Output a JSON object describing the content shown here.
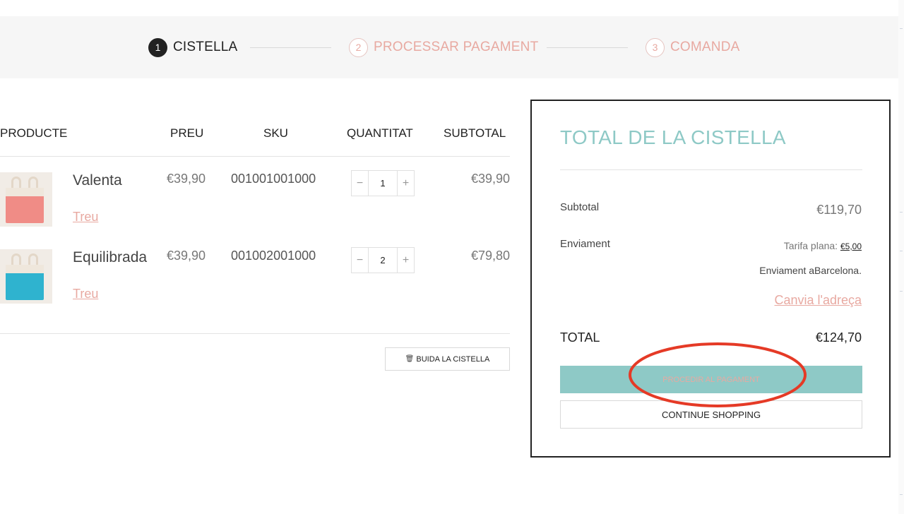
{
  "steps": [
    {
      "number": "1",
      "label": "CISTELLA"
    },
    {
      "number": "2",
      "label": "PROCESSAR PAGAMENT"
    },
    {
      "number": "3",
      "label": "COMANDA"
    }
  ],
  "table": {
    "headers": {
      "product": "PRODUCTE",
      "price": "PREU",
      "sku": "SKU",
      "quantity": "QUANTITAT",
      "subtotal": "SUBTOTAL"
    },
    "rows": [
      {
        "name": "Valenta",
        "price": "€39,90",
        "sku": "001001001000",
        "qty": "1",
        "subtotal": "€39,90",
        "remove": "Treu",
        "color": "#f08c86"
      },
      {
        "name": "Equilibrada",
        "price": "€39,90",
        "sku": "001002001000",
        "qty": "2",
        "subtotal": "€79,80",
        "remove": "Treu",
        "color": "#2fb3cf"
      }
    ],
    "qty_minus": "−",
    "qty_plus": "+",
    "empty_cart_icon": "trash-icon",
    "empty_cart_glyph": "🗑",
    "empty_cart_label": "BUIDA LA CISTELLA"
  },
  "totals": {
    "title": "TOTAL DE LA CISTELLA",
    "subtotal_label": "Subtotal",
    "subtotal_value": "€119,70",
    "shipping_label": "Enviament",
    "shipping_rate_label": "Tarifa plana:",
    "shipping_rate_value": "€5,00",
    "shipping_destination": "Enviament aBarcelona.",
    "change_address": "Canvia l'adreça",
    "total_label": "TOTAL",
    "total_value": "€124,70",
    "checkout_button": "PROCEDIR AL PAGAMENT",
    "continue_button": "CONTINUE SHOPPING"
  },
  "colors": {
    "accent_teal": "#8ec9c6",
    "accent_pink": "#e8a9a1",
    "annotation_red": "#e53a26"
  }
}
